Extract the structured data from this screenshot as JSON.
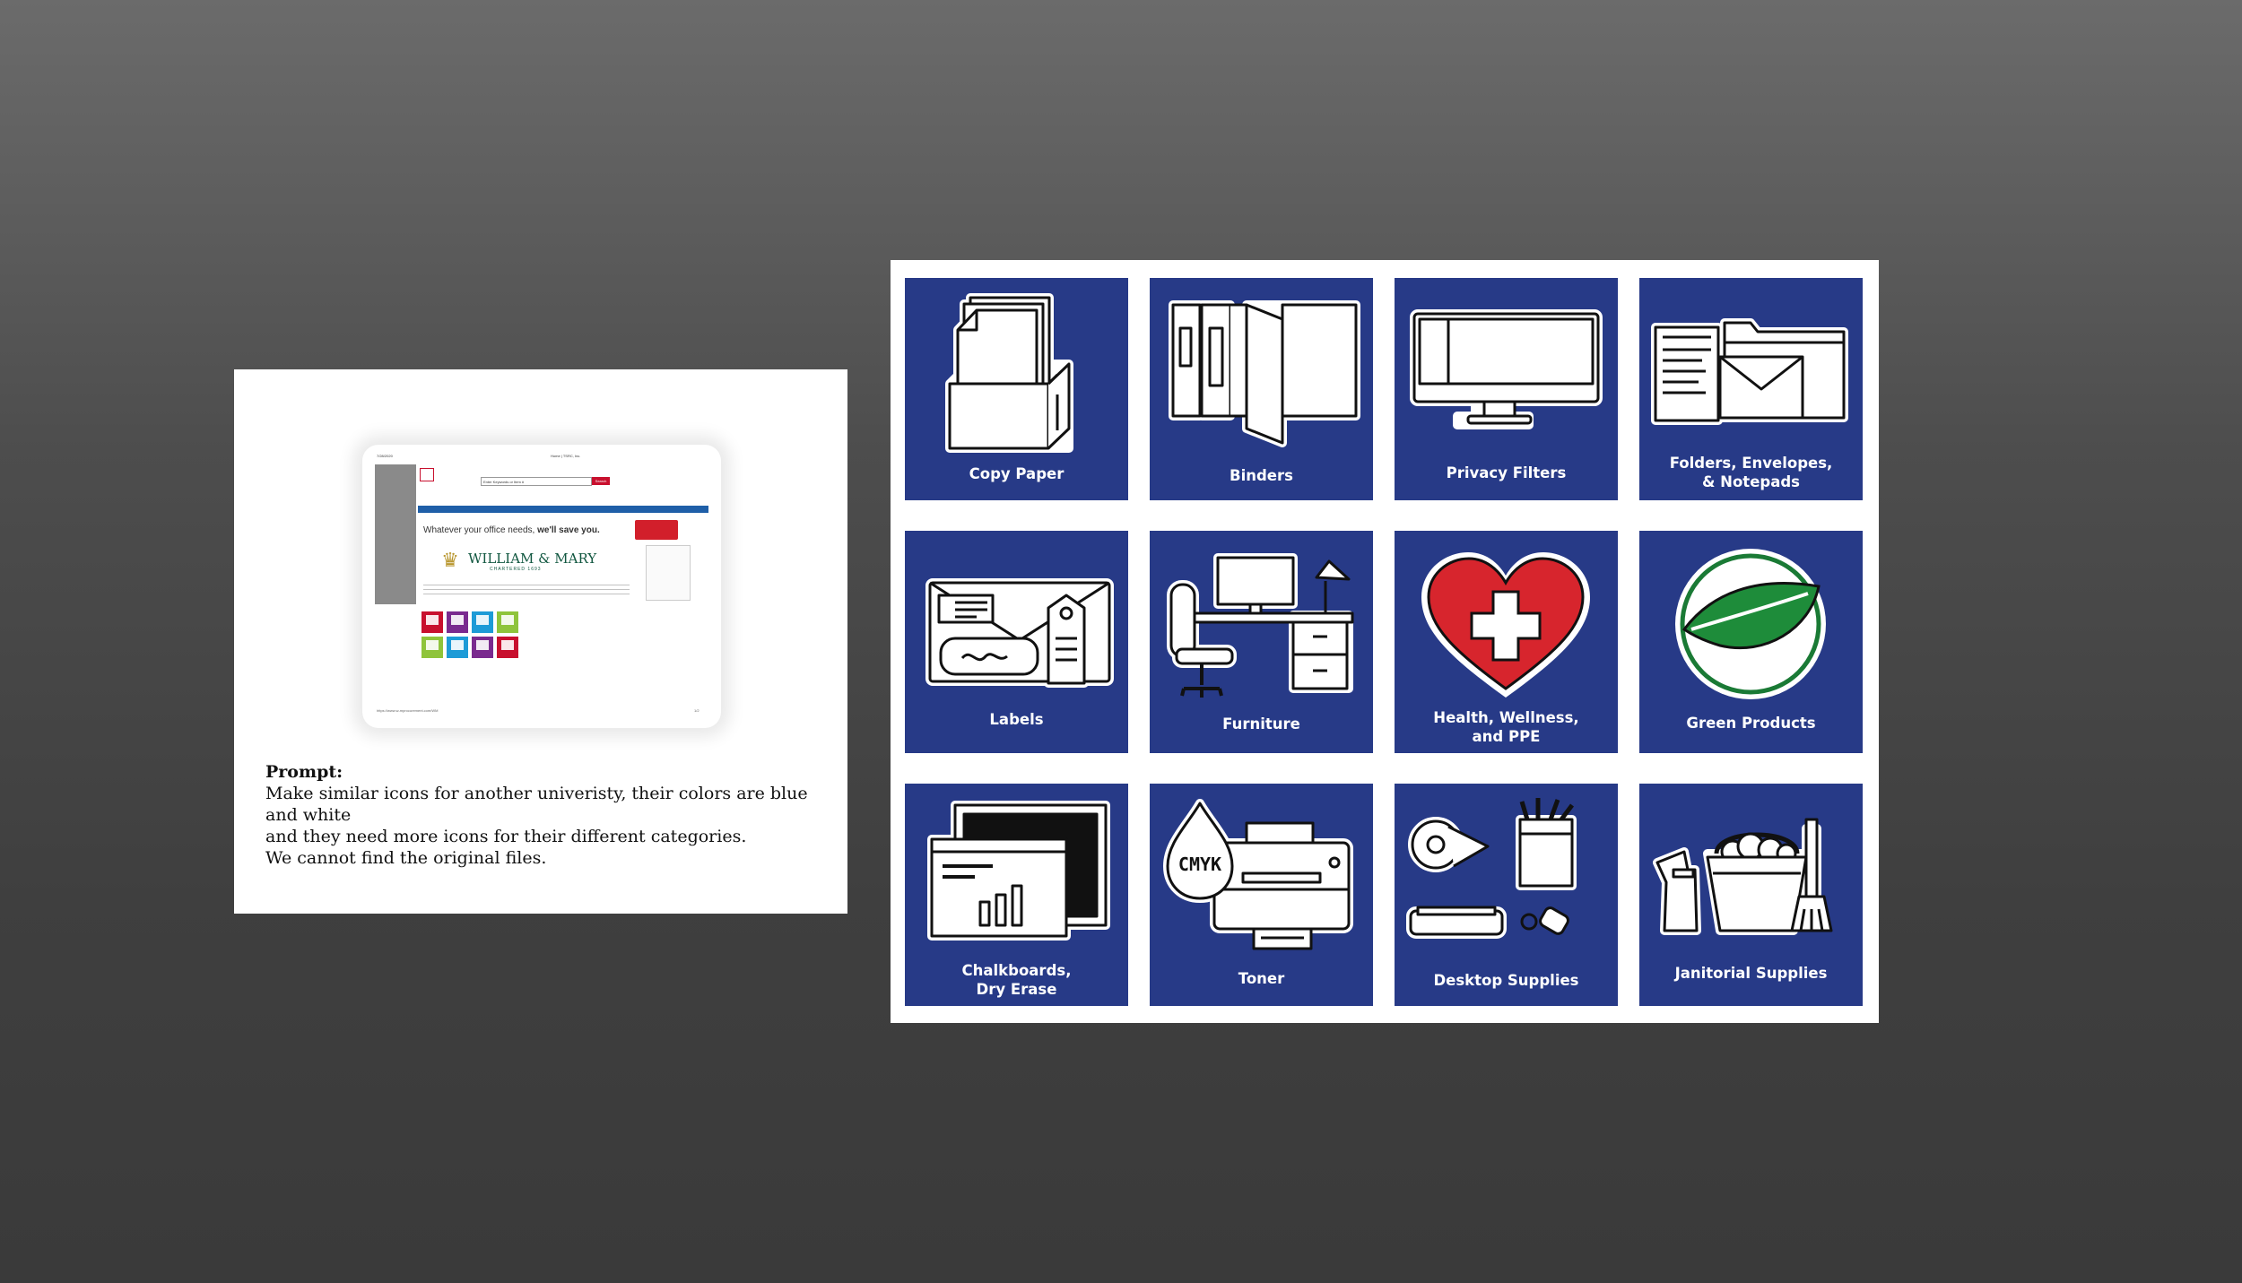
{
  "left_card": {
    "screenshot": {
      "tiny_left": "7/28/2020",
      "tiny_center": "Home | TSRC, Inc.",
      "search_placeholder": "Enter Keywords or Item #",
      "search_button": "Search",
      "banner_prefix": "Whatever your office needs, ",
      "banner_bold": "we'll save you.",
      "university_name": "WILLIAM & MARY",
      "university_sub": "CHARTERED 1693",
      "footer_url": "https://www.w-mprocurement.com/WM",
      "footer_page": "1/2"
    },
    "prompt": {
      "title": "Prompt:",
      "line1": "Make similar icons for another univeristy, their colors are blue and white",
      "line2": "and they need more icons for their different categories.",
      "line3": "We cannot find the original files."
    }
  },
  "icon_grid": {
    "tile_color": "#273a87",
    "tiles": [
      {
        "label": "Copy Paper",
        "icon": "copy-paper-icon"
      },
      {
        "label": "Binders",
        "icon": "binders-icon"
      },
      {
        "label": "Privacy Filters",
        "icon": "monitor-icon"
      },
      {
        "label_line1": "Folders, Envelopes,",
        "label_line2": "& Notepads",
        "icon": "folders-envelopes-icon"
      },
      {
        "label": "Labels",
        "icon": "labels-icon"
      },
      {
        "label": "Furniture",
        "icon": "furniture-icon"
      },
      {
        "label_line1": "Health, Wellness,",
        "label_line2": "and PPE",
        "icon": "health-heart-icon"
      },
      {
        "label": "Green Products",
        "icon": "leaf-icon"
      },
      {
        "label_line1": "Chalkboards,",
        "label_line2": "Dry Erase",
        "icon": "chalkboard-icon"
      },
      {
        "label": "Toner",
        "icon": "printer-toner-icon",
        "drop_text": "CMYK"
      },
      {
        "label": "Desktop Supplies",
        "icon": "desktop-supplies-icon"
      },
      {
        "label": "Janitorial Supplies",
        "icon": "janitorial-icon"
      }
    ]
  }
}
